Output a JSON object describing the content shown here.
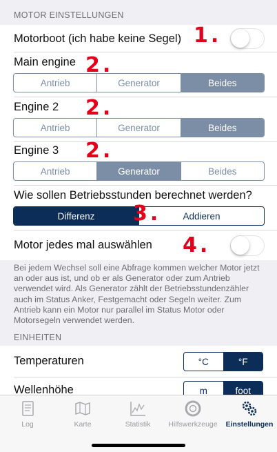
{
  "motor_section": {
    "header": "MOTOR EINSTELLUNGEN",
    "motorboat_label": "Motorboot (ich habe keine Segel)",
    "main_engine_label": "Main engine",
    "engine2_label": "Engine 2",
    "engine3_label": "Engine 3",
    "engine_options": [
      "Antrieb",
      "Generator",
      "Beides"
    ],
    "hours_question": "Wie sollen Betriebsstunden berechnet werden?",
    "hours_options": [
      "Differenz",
      "Addieren"
    ],
    "select_each_label": "Motor jedes mal auswählen",
    "footnote": "Bei jedem Wechsel soll eine Abfrage kommen welcher Motor jetzt an oder aus ist, und ob er als Generator oder zum Antrieb verwendet wird. Als Generator zählt der Betriebsstundenzähler auch im Status Anker, Festgemacht oder Segeln weiter. Zum Antrieb kann ein Motor nur parallel im Status Motor oder Motorsegeln verwendet werden."
  },
  "units_section": {
    "header": "EINHEITEN",
    "temperature_label": "Temperaturen",
    "temperature_options": [
      "°C",
      "°F"
    ],
    "wave_label": "Wellenhöhe",
    "wave_options": [
      "m",
      "foot"
    ]
  },
  "annotations": [
    "1.",
    "2.",
    "2.",
    "2.",
    "3.",
    "4."
  ],
  "tabbar": {
    "tabs": [
      {
        "label": "Log",
        "icon": "log-icon"
      },
      {
        "label": "Karte",
        "icon": "map-icon"
      },
      {
        "label": "Statistik",
        "icon": "chart-icon"
      },
      {
        "label": "Hilfswerkzeuge",
        "icon": "lifebuoy-icon"
      },
      {
        "label": "Einstellungen",
        "icon": "gears-icon"
      }
    ],
    "active": "Einstellungen"
  },
  "colors": {
    "accent_dark": "#0b2d57",
    "segment_blue_gray": "#7b8ea6",
    "annotation_red": "#e2001a"
  }
}
